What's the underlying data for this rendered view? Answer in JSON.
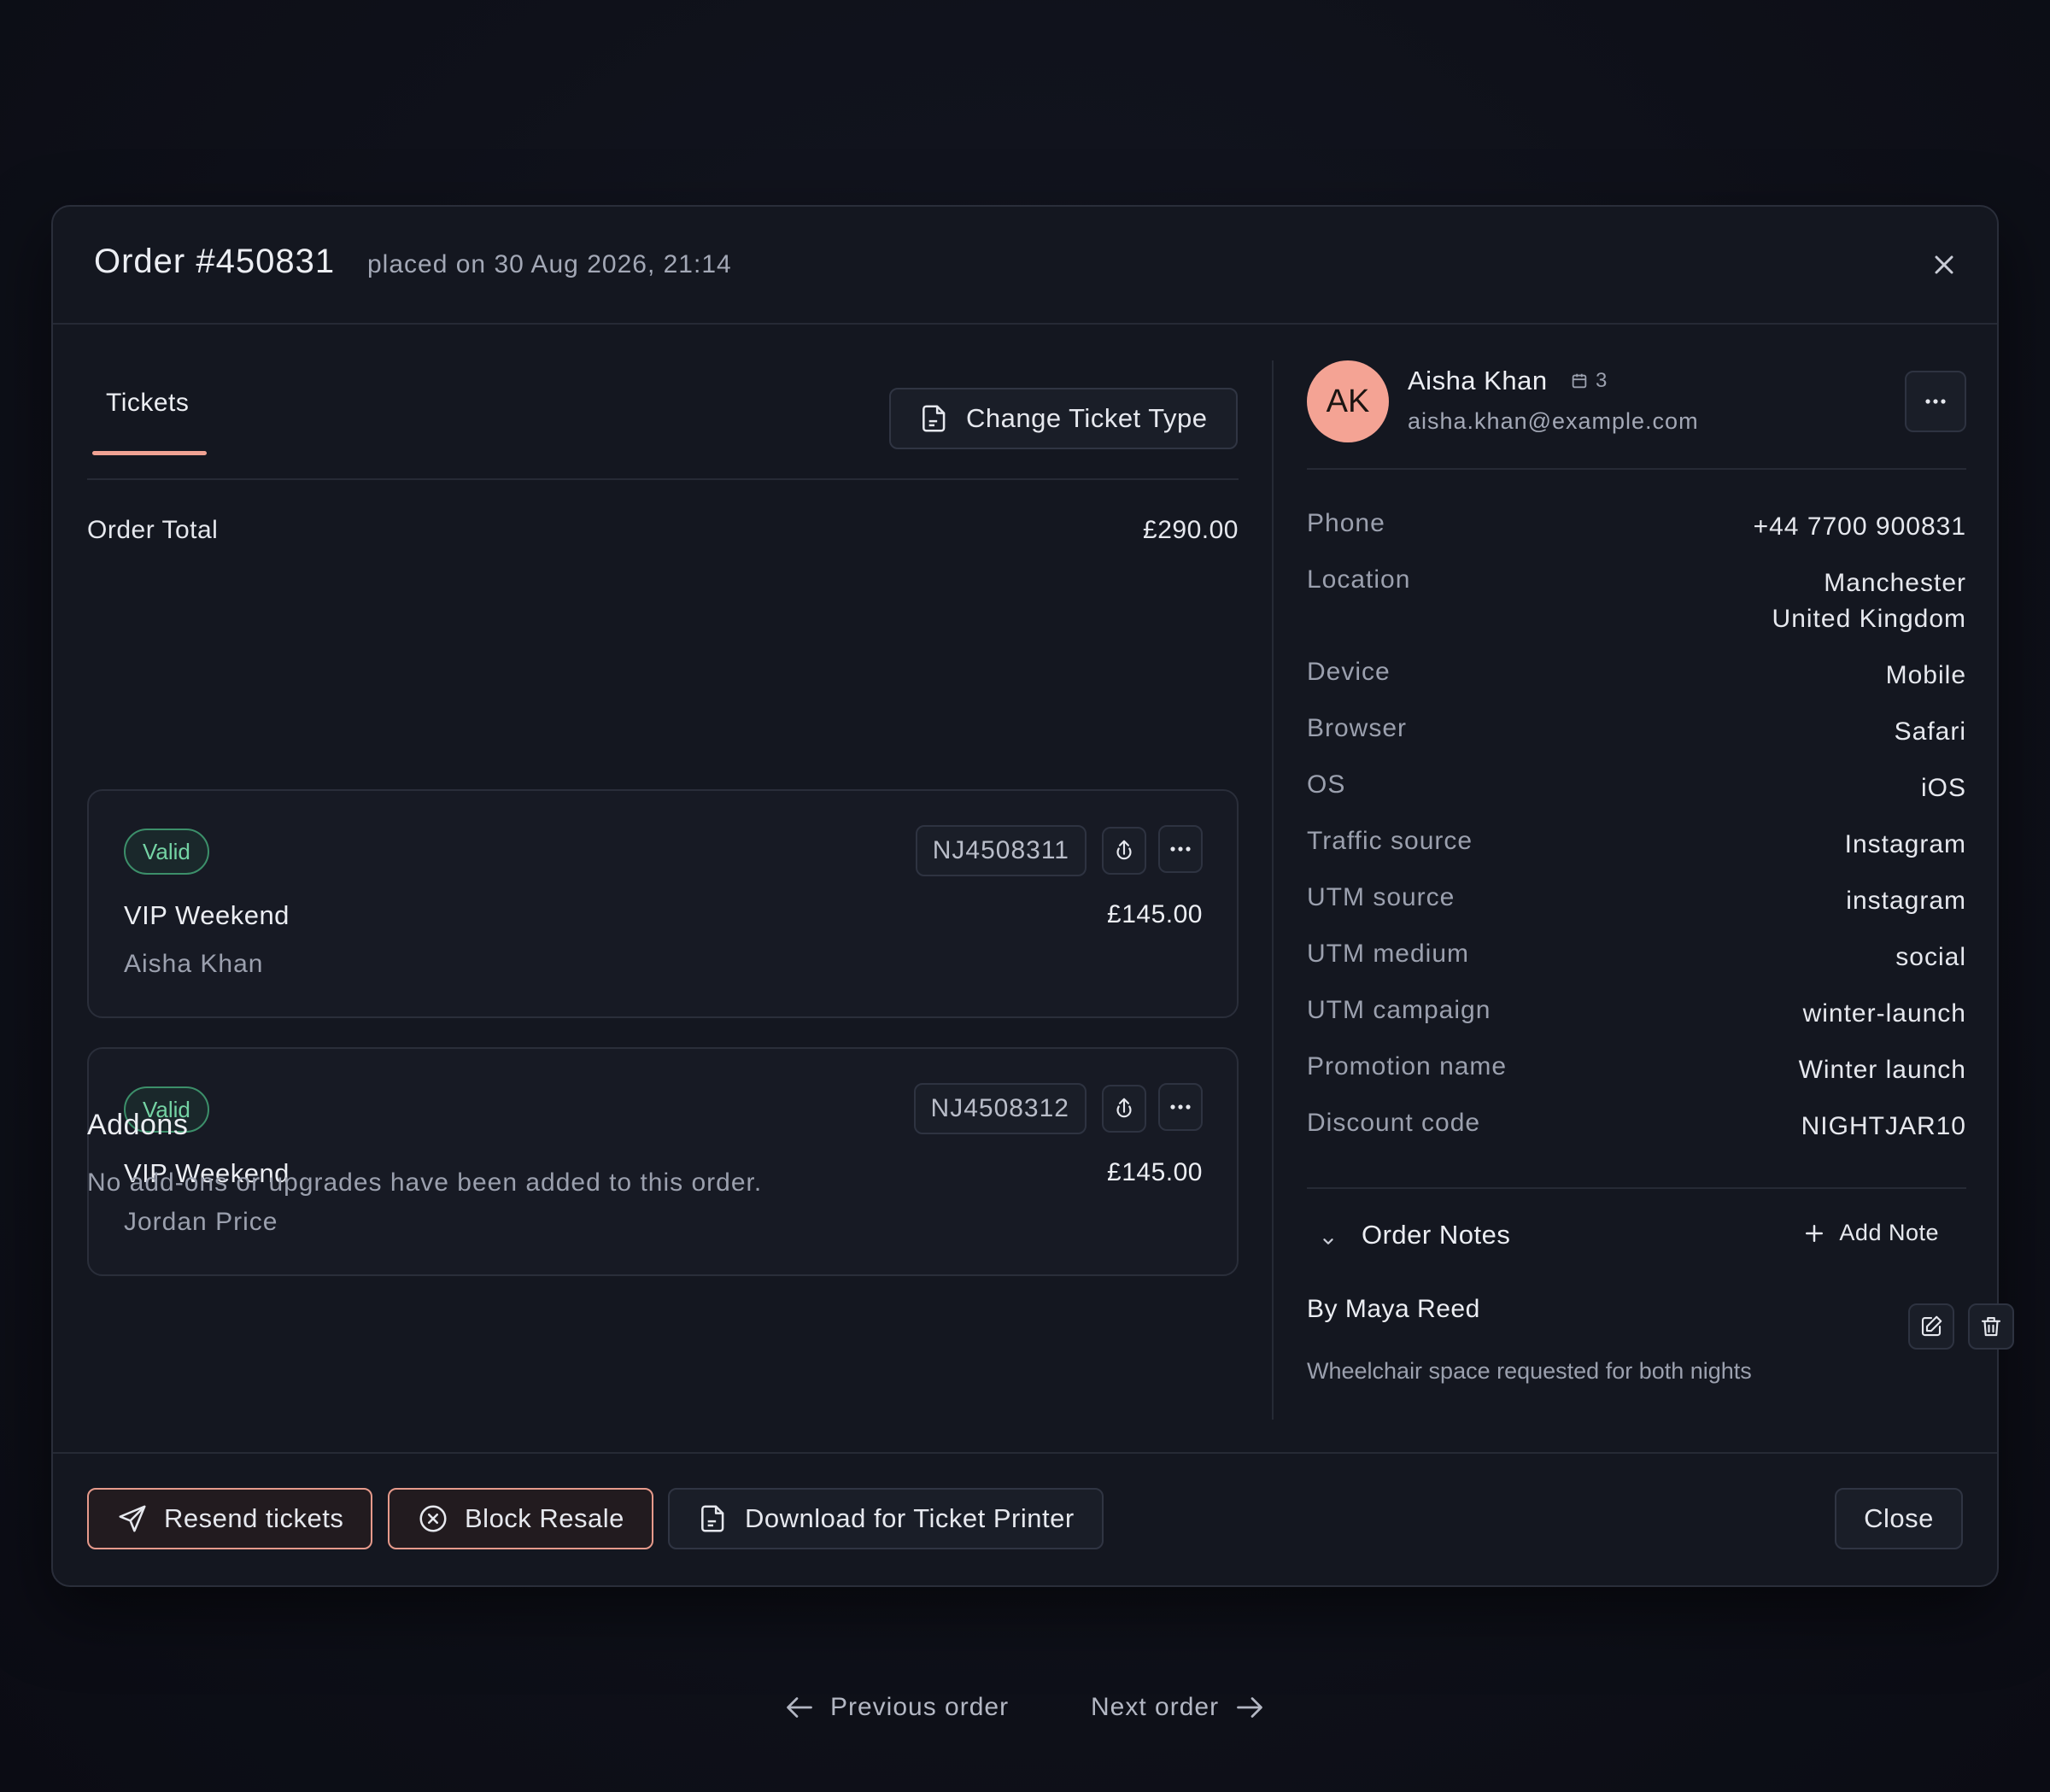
{
  "order": {
    "title": "Order #450831",
    "placed": "placed on 30 Aug 2026, 21:14"
  },
  "tabs": {
    "tickets": "Tickets"
  },
  "actions": {
    "change_ticket_type": "Change Ticket Type"
  },
  "summary": {
    "total_label": "Order Total",
    "total_value": "£290.00"
  },
  "tickets": [
    {
      "status": "Valid",
      "code": "NJ4508311",
      "type": "VIP Weekend",
      "price": "£145.00",
      "holder": "Aisha Khan"
    },
    {
      "status": "Valid",
      "code": "NJ4508312",
      "type": "VIP Weekend",
      "price": "£145.00",
      "holder": "Jordan Price"
    }
  ],
  "addons": {
    "title": "Addons",
    "empty_text": "No add-ons or upgrades have been added to this order."
  },
  "customer": {
    "initials": "AK",
    "name": "Aisha Khan",
    "order_count": "3",
    "email": "aisha.khan@example.com"
  },
  "details": [
    {
      "label": "Phone",
      "value": "+44 7700 900831"
    },
    {
      "label": "Location",
      "value": "Manchester\nUnited Kingdom"
    },
    {
      "label": "Device",
      "value": "Mobile"
    },
    {
      "label": "Browser",
      "value": "Safari"
    },
    {
      "label": "OS",
      "value": "iOS"
    },
    {
      "label": "Traffic source",
      "value": "Instagram"
    },
    {
      "label": "UTM source",
      "value": "instagram"
    },
    {
      "label": "UTM medium",
      "value": "social"
    },
    {
      "label": "UTM campaign",
      "value": "winter-launch"
    },
    {
      "label": "Promotion name",
      "value": "Winter launch"
    },
    {
      "label": "Discount code",
      "value": "NIGHTJAR10"
    }
  ],
  "notes": {
    "title": "Order Notes",
    "add_label": "Add Note",
    "author": "By Maya Reed",
    "text": "Wheelchair space requested for both nights"
  },
  "footer": {
    "resend": "Resend tickets",
    "block": "Block Resale",
    "download": "Download for Ticket Printer",
    "close": "Close"
  },
  "pager": {
    "prev": "Previous order",
    "next": "Next order"
  },
  "colors": {
    "accent": "#f0a293",
    "valid": "#74d3a4",
    "avatar": "#f4a394"
  }
}
